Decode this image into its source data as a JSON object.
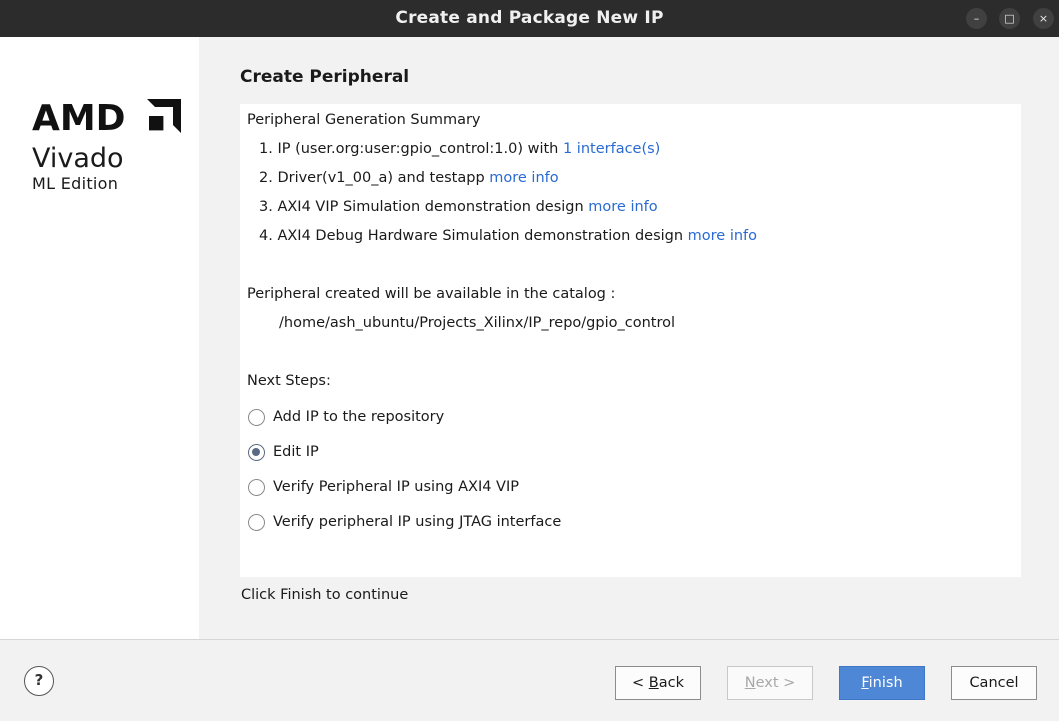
{
  "window": {
    "title": "Create and Package New IP",
    "controls": {
      "minimize": "–",
      "maximize": "□",
      "close": "×"
    }
  },
  "brand": {
    "line1": "Vivado",
    "line2": "ML Edition"
  },
  "page": {
    "title": "Create Peripheral",
    "summary_heading": "Peripheral Generation Summary",
    "summary_items": [
      {
        "text": "1. IP (user.org:user:gpio_control:1.0) with",
        "link": "1 interface(s)"
      },
      {
        "text": "2. Driver(v1_00_a) and testapp",
        "link": "more info"
      },
      {
        "text": "3. AXI4 VIP Simulation demonstration design",
        "link": "more info"
      },
      {
        "text": "4. AXI4 Debug Hardware Simulation demonstration design",
        "link": "more info"
      }
    ],
    "catalog_label": "Peripheral created will be available in the catalog :",
    "catalog_path": "/home/ash_ubuntu/Projects_Xilinx/IP_repo/gpio_control",
    "next_steps_label": "Next Steps:",
    "next_steps": [
      {
        "label": "Add IP to the repository",
        "checked": false
      },
      {
        "label": "Edit IP",
        "checked": true
      },
      {
        "label": "Verify Peripheral IP using AXI4 VIP",
        "checked": false
      },
      {
        "label": "Verify peripheral IP using JTAG interface",
        "checked": false
      }
    ],
    "continue_hint": "Click Finish to continue"
  },
  "footer": {
    "help": "?",
    "back": {
      "prefix": "< ",
      "mnemonic": "B",
      "rest": "ack"
    },
    "next": {
      "mnemonic": "N",
      "rest": "ext >"
    },
    "finish": {
      "mnemonic": "F",
      "rest": "inish"
    },
    "cancel": "Cancel"
  }
}
